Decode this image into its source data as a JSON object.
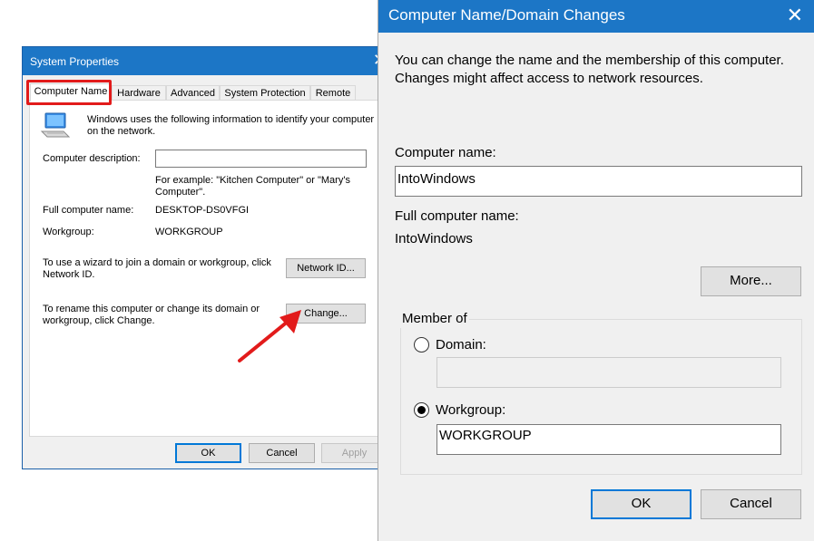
{
  "system_properties": {
    "title": "System Properties",
    "tabs": [
      "Computer Name",
      "Hardware",
      "Advanced",
      "System Protection",
      "Remote"
    ],
    "intro": "Windows uses the following information to identify your computer on the network.",
    "description_label": "Computer description:",
    "description_value": "",
    "example_text": "For example: \"Kitchen Computer\" or \"Mary's Computer\".",
    "full_name_label": "Full computer name:",
    "full_name_value": "DESKTOP-DS0VFGI",
    "workgroup_label": "Workgroup:",
    "workgroup_value": "WORKGROUP",
    "network_id_text": "To use a wizard to join a domain or workgroup, click Network ID.",
    "network_id_button": "Network ID...",
    "rename_text": "To rename this computer or change its domain or workgroup, click Change.",
    "change_button": "Change...",
    "ok_button": "OK",
    "cancel_button": "Cancel",
    "apply_button": "Apply"
  },
  "domain_changes": {
    "title": "Computer Name/Domain Changes",
    "intro": "You can change the name and the membership of this computer. Changes might affect access to network resources.",
    "computer_name_label": "Computer name:",
    "computer_name_value": "IntoWindows",
    "full_name_label": "Full computer name:",
    "full_name_value": "IntoWindows",
    "more_button": "More...",
    "member_of_label": "Member of",
    "domain_label": "Domain:",
    "domain_value": "",
    "workgroup_label": "Workgroup:",
    "workgroup_value": "WORKGROUP",
    "selected_membership": "Workgroup",
    "ok_button": "OK",
    "cancel_button": "Cancel"
  },
  "colors": {
    "titlebar": "#1c76c6",
    "highlight": "#e21b1b",
    "arrow": "#e21b1b",
    "default_button_border": "#0078d7"
  },
  "icons": {
    "close": "close-icon",
    "computer": "computer-icon",
    "annotation": "red-arrow-annotation"
  }
}
